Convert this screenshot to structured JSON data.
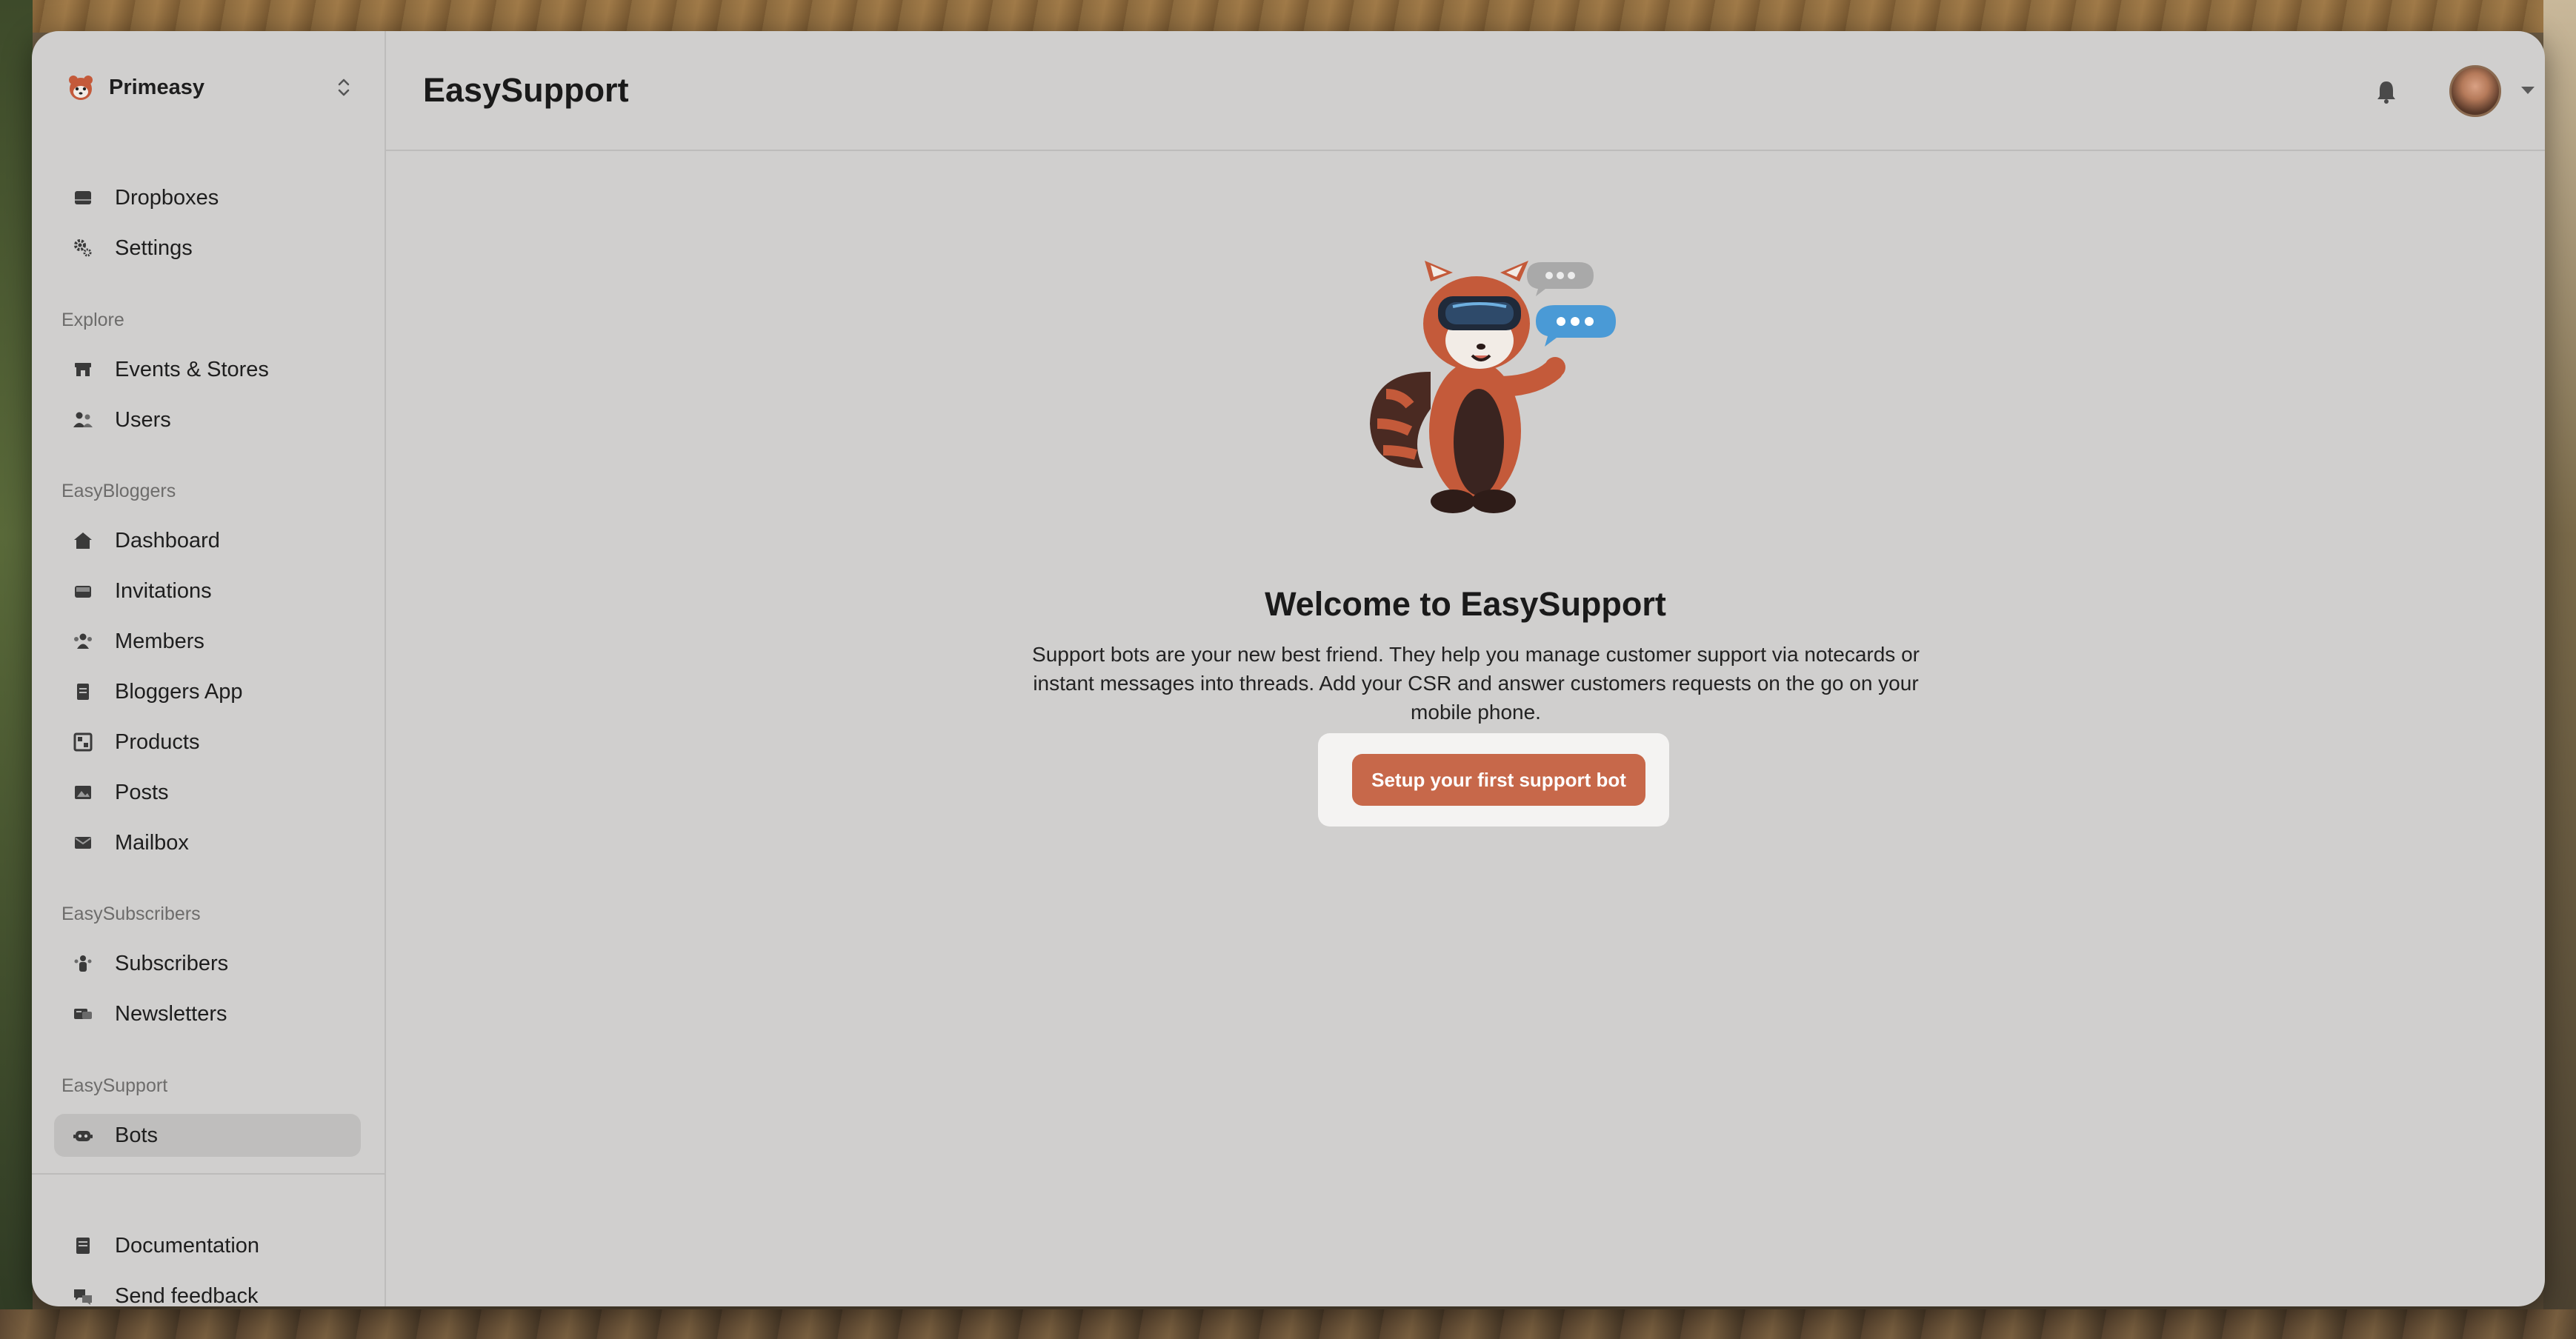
{
  "workspace": {
    "name": "Primeasy"
  },
  "sidebar": {
    "top_items": [
      {
        "label": "Dropboxes",
        "icon": "dropbox-icon"
      },
      {
        "label": "Settings",
        "icon": "gear-icon"
      }
    ],
    "sections": [
      {
        "title": "Explore",
        "items": [
          {
            "label": "Events & Stores",
            "icon": "store-icon"
          },
          {
            "label": "Users",
            "icon": "users-icon"
          }
        ]
      },
      {
        "title": "EasyBloggers",
        "items": [
          {
            "label": "Dashboard",
            "icon": "home-icon"
          },
          {
            "label": "Invitations",
            "icon": "inbox-icon"
          },
          {
            "label": "Members",
            "icon": "members-icon"
          },
          {
            "label": "Bloggers App",
            "icon": "document-icon"
          },
          {
            "label": "Products",
            "icon": "products-icon"
          },
          {
            "label": "Posts",
            "icon": "image-icon"
          },
          {
            "label": "Mailbox",
            "icon": "mail-icon"
          }
        ]
      },
      {
        "title": "EasySubscribers",
        "items": [
          {
            "label": "Subscribers",
            "icon": "subscribers-icon"
          },
          {
            "label": "Newsletters",
            "icon": "newsletter-icon"
          }
        ]
      },
      {
        "title": "EasySupport",
        "items": [
          {
            "label": "Bots",
            "icon": "bot-icon",
            "active": true
          }
        ]
      }
    ],
    "footer_items": [
      {
        "label": "Documentation",
        "icon": "book-icon"
      },
      {
        "label": "Send feedback",
        "icon": "chat-icon"
      }
    ]
  },
  "header": {
    "title": "EasySupport"
  },
  "main": {
    "welcome_title": "Welcome to EasySupport",
    "welcome_desc": "Support bots are your new best friend. They help you manage customer support via notecards or instant messages into threads. Add your CSR and answer customers requests on the go on your mobile phone.",
    "cta_label": "Setup your first support bot"
  },
  "colors": {
    "accent": "#c7684a",
    "sidebar_active": "#bfbebd",
    "window_bg": "#d0cfce"
  }
}
